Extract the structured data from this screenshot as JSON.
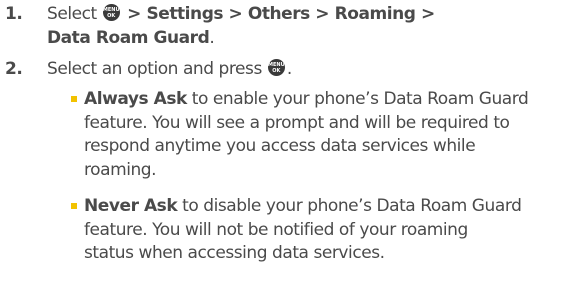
{
  "steps": [
    {
      "number": "1.",
      "line1_prefix": "Select",
      "line1_path": " > Settings > Others > Roaming >",
      "line2_path": "Data Roam Guard",
      "line2_suffix": "."
    },
    {
      "number": "2.",
      "text": "Select an option and press",
      "suffix": "."
    }
  ],
  "menu_key": {
    "icon": "menu-ok-key-icon",
    "top_label": "MENU",
    "bottom_label": "OK"
  },
  "options": [
    {
      "title": "Always Ask",
      "lines": [
        " to enable your phone’s Data Roam Guard",
        "feature. You will see a prompt and will be required to",
        "respond anytime you access data services while",
        "roaming."
      ]
    },
    {
      "title": "Never Ask",
      "lines": [
        " to disable your phone’s Data Roam Guard",
        "feature. You will not be notified of your roaming",
        "status when accessing data services."
      ]
    }
  ],
  "colors": {
    "text": "#4a4a4a",
    "bullet": "#f2c200",
    "key": "#3a3a3a"
  }
}
